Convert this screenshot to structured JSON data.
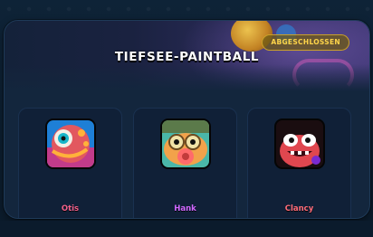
{
  "event": {
    "title": "TIEFSEE-PAINTBALL",
    "status_badge": "ABGESCHLOSSEN"
  },
  "brawlers": [
    {
      "name": "Otis",
      "name_color": "#f0608a",
      "icon": "otis-portrait-icon"
    },
    {
      "name": "Hank",
      "name_color": "#d068ff",
      "icon": "hank-portrait-icon"
    },
    {
      "name": "Clancy",
      "name_color": "#ff6d7a",
      "icon": "clancy-portrait-icon"
    }
  ],
  "colors": {
    "badge_text": "#ffd54a",
    "badge_border": "#c9a028",
    "panel": "#13263d",
    "card": "#102037"
  }
}
